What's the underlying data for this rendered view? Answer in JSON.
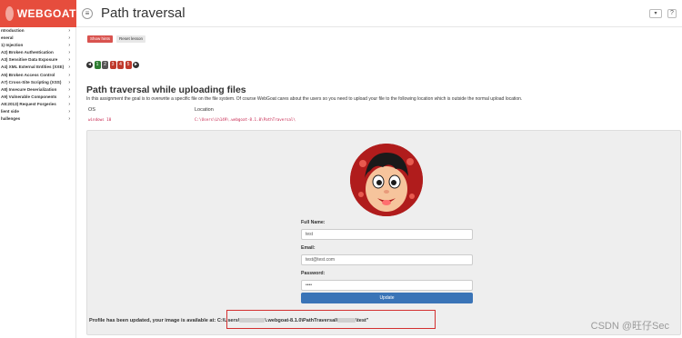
{
  "header": {
    "logo_text": "WEBGOAT",
    "page_title": "Path traversal",
    "menu_icon": "hamburger-icon",
    "user_icon": "user-icon",
    "help_icon": "question-icon"
  },
  "sidebar": {
    "items": [
      {
        "label": "ntroduction"
      },
      {
        "label": "eneral"
      },
      {
        "label": "1) Injection"
      },
      {
        "label": "A2) Broken Authentication"
      },
      {
        "label": "A3) Sensitive Data Exposure"
      },
      {
        "label": "A4) XML External Entities (XXE)"
      },
      {
        "label": "A5) Broken Access Control"
      },
      {
        "label": "A7) Cross-Site Scripting (XSS)"
      },
      {
        "label": "A8) Insecure Deserialization"
      },
      {
        "label": "A9) Vulnerable Components"
      },
      {
        "label": "A8:2013) Request Forgeries"
      },
      {
        "label": "lient side"
      },
      {
        "label": "hallenges"
      }
    ],
    "chevron": "›"
  },
  "toolbar": {
    "show_hints": "Show hints",
    "reset_lesson": "Reset lesson"
  },
  "pager": {
    "prev_icon": "◄",
    "next_icon": "►",
    "pages": [
      "1",
      "2",
      "3",
      "4",
      "5"
    ],
    "current_page": 2,
    "completed_pages": [
      1
    ]
  },
  "lesson": {
    "title": "Path traversal while uploading files",
    "description": "In this assignment the goal is to overwrite a specific file on the file system. Of course WebGoat cares about the users so you need to upload your file to the following location which is outside the normal upload location.",
    "os_header": "OS",
    "location_header": "Location",
    "os_value": "windows 10",
    "location_value": "C:\\Users\\Lh149\\.webgoat-8.1.0\\PathTraversal\\"
  },
  "form": {
    "full_name_label": "Full Name:",
    "full_name_value": "test",
    "email_label": "Email:",
    "email_value": "test@test.com",
    "password_label": "Password:",
    "password_value": "••••",
    "update_label": "Update"
  },
  "status": {
    "prefix": "Profile has been updated, your image is available at: C:\\Users\\",
    "middle": "\\.webgoat-8.1.0\\PathTraversal\\",
    "suffix": "\\test\""
  },
  "watermark": "CSDN @旺仔Sec",
  "colors": {
    "brand": "#e64d3d",
    "update_button": "#3a74b7",
    "highlight": "#d32f2f"
  }
}
